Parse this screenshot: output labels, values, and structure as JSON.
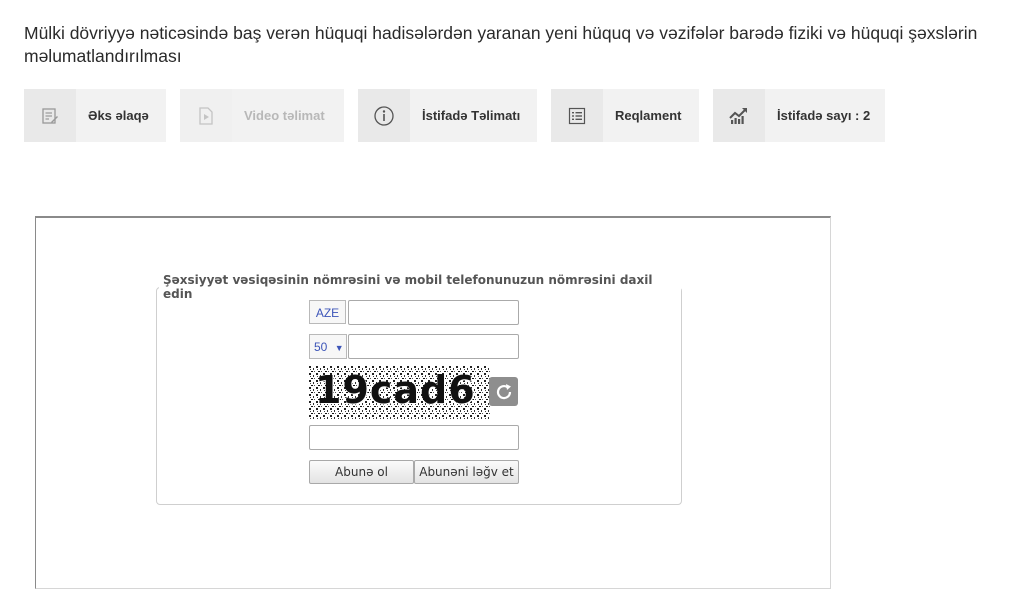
{
  "page": {
    "title": "Mülki dövriyyə nəticəsində baş verən hüquqi hadisələrdən yaranan yeni hüquq və vəzifələr barədə fiziki və hüquqi şəxslərin məlumatlandırılması"
  },
  "toolbar": {
    "items": [
      {
        "label": "Əks əlaqə",
        "icon": "feedback-icon"
      },
      {
        "label": "Video təlimat",
        "icon": "video-icon",
        "disabled": true
      },
      {
        "label": "İstifadə Təlimatı",
        "icon": "info-icon"
      },
      {
        "label": "Reqlament",
        "icon": "list-icon"
      },
      {
        "label": "İstifadə sayı : 2",
        "icon": "usage-chart-icon"
      }
    ]
  },
  "form": {
    "legend": "Şəxsiyyət vəsiqəsinin nömrəsini və mobil telefonunuzun nömrəsini daxil edin",
    "id_prefix": "AZE",
    "id_value": "",
    "phone_code": "50",
    "phone_value": "",
    "captcha_text": "19cad6",
    "captcha_value": "",
    "subscribe_label": "Abunə ol",
    "unsubscribe_label": "Abunəni ləğv et"
  },
  "colors": {
    "toolbar_bg": "#f2f2f2",
    "prefix_text": "#3d55b8"
  }
}
